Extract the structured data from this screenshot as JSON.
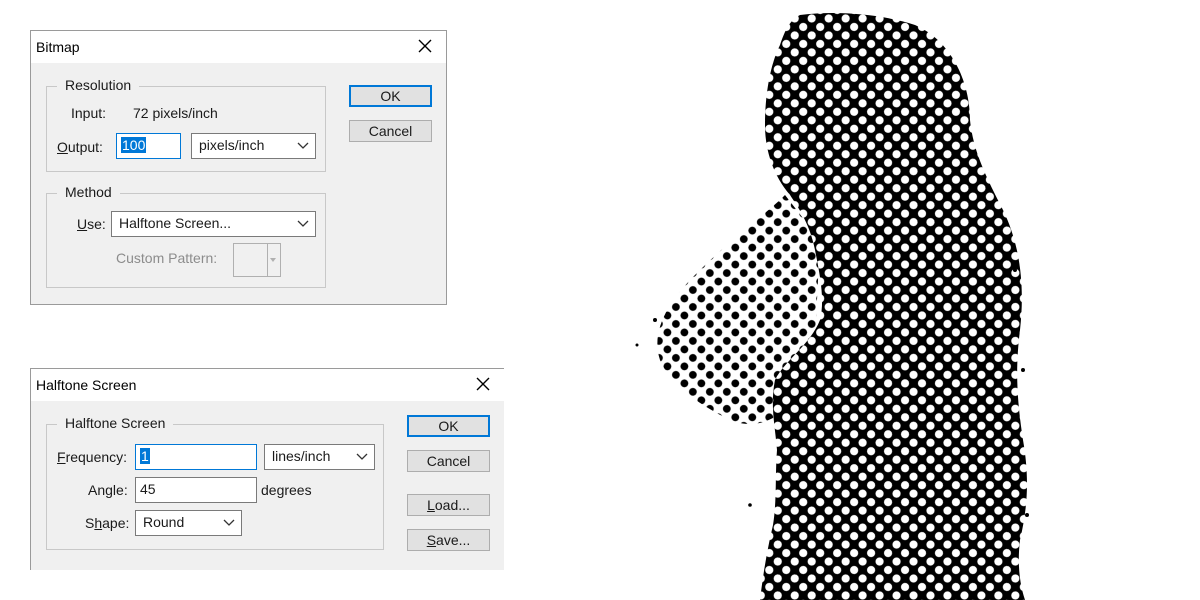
{
  "bitmap_dialog": {
    "title": "Bitmap",
    "resolution": {
      "legend": "Resolution",
      "input_label": "Input:",
      "input_value": "72 pixels/inch",
      "output_label_pre": "",
      "output_label_ul": "O",
      "output_label_post": "utput:",
      "output_value": "100",
      "output_unit": "pixels/inch"
    },
    "method": {
      "legend": "Method",
      "use_label_ul": "U",
      "use_label_post": "se:",
      "use_value": "Halftone Screen...",
      "custom_pattern_label": "Custom Pattern:"
    },
    "ok_label": "OK",
    "cancel_label": "Cancel"
  },
  "halftone_dialog": {
    "title": "Halftone Screen",
    "group_legend": "Halftone Screen",
    "frequency_label_ul": "F",
    "frequency_label_post": "requency:",
    "frequency_value": "1",
    "frequency_unit": "lines/inch",
    "angle_label_pre": "An",
    "angle_label_ul": "g",
    "angle_label_post": "le:",
    "angle_value": "45",
    "angle_unit": "degrees",
    "shape_label_pre": "S",
    "shape_label_ul": "h",
    "shape_label_post": "ape:",
    "shape_value": "Round",
    "ok_label": "OK",
    "cancel_label": "Cancel",
    "load_label_ul": "L",
    "load_label_post": "oad...",
    "save_label_ul": "S",
    "save_label_post": "ave..."
  },
  "colors": {
    "accent": "#0078d7",
    "dialog_bg": "#f0f0f0",
    "halftone_ink": "#000000"
  }
}
